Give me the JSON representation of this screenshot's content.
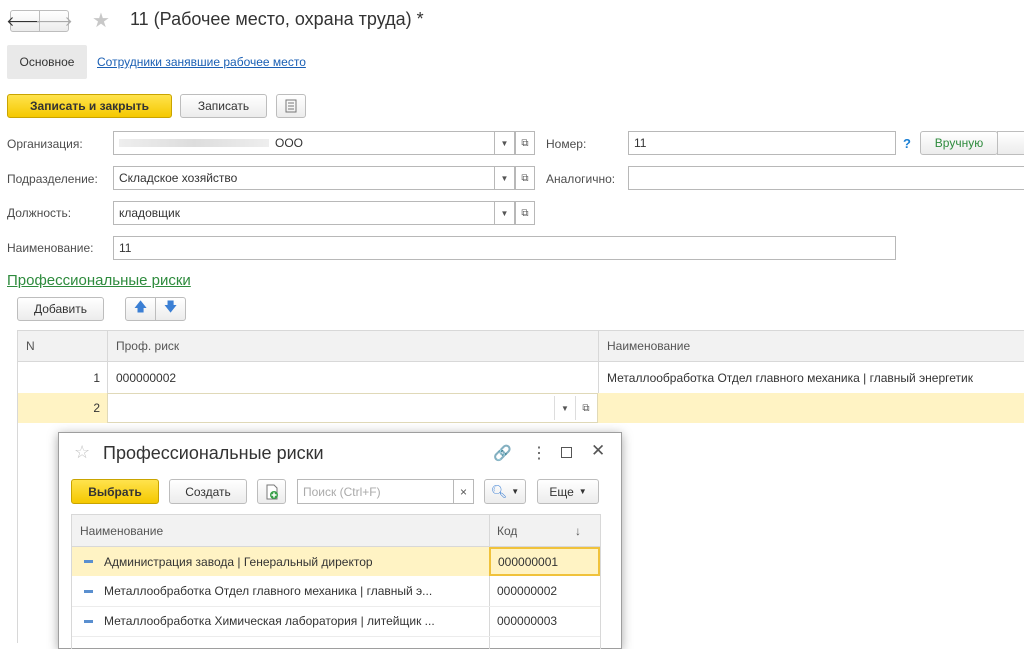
{
  "window": {
    "title": "11 (Рабочее место, охрана труда) *",
    "back_icon": "arrow-left-icon",
    "forward_icon": "arrow-right-icon",
    "star_icon": "star-icon"
  },
  "tabs": [
    {
      "label": "Основное"
    },
    {
      "label": "Сотрудники занявшие рабочее место"
    }
  ],
  "toolbar": {
    "save_close_label": "Записать и закрыть",
    "save_label": "Записать"
  },
  "form": {
    "org_label": "Организация:",
    "org_value": "ООО",
    "number_label": "Номер:",
    "number_value": "11",
    "help_label": "?",
    "manual_label": "Вручную",
    "dept_label": "Подразделение:",
    "dept_value": "Складское хозяйство",
    "similar_label": "Аналогично:",
    "similar_value": "",
    "position_label": "Должность:",
    "position_value": "кладовщик",
    "name_label": "Наименование:",
    "name_value": "11"
  },
  "risks": {
    "section_title": "Профессиональные риски",
    "add_label": "Добавить",
    "columns": {
      "n": "N",
      "risk": "Проф. риск",
      "name": "Наименование"
    },
    "rows": [
      {
        "n": "1",
        "risk": "000000002",
        "name": "Металлообработка  Отдел главного механика |  главный энергетик"
      },
      {
        "n": "2",
        "risk": "",
        "name": ""
      }
    ]
  },
  "popup": {
    "title": "Профессиональные риски",
    "select_label": "Выбрать",
    "create_label": "Создать",
    "search_placeholder": "Поиск (Ctrl+F)",
    "clear_label": "×",
    "more_label": "Еще",
    "columns": {
      "name": "Наименование",
      "code": "Код",
      "sort": "↓"
    },
    "rows": [
      {
        "name": "Администрация завода |  Генеральный директор",
        "code": "000000001"
      },
      {
        "name": "Металлообработка  Отдел главного механика |  главный э...",
        "code": "000000002"
      },
      {
        "name": "Металлообработка  Химическая лаборатория |  литейщик ...",
        "code": "000000003"
      }
    ]
  },
  "colors": {
    "accent_yellow": "#f5c800",
    "row_highlight": "#fff3c4",
    "link_blue": "#1a5fb4",
    "section_green": "#2e8b3d",
    "arrow_blue": "#3b7fd4"
  }
}
